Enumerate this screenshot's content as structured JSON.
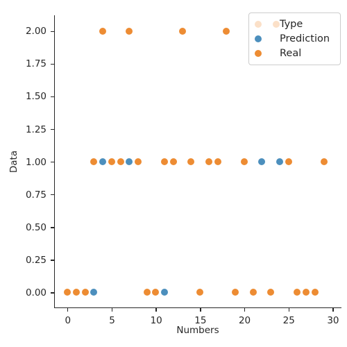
{
  "chart_data": {
    "type": "scatter",
    "title": "",
    "xlabel": "Numbers",
    "ylabel": "Data",
    "xlim": [
      -1.5,
      31.0
    ],
    "ylim": [
      -0.12,
      2.12
    ],
    "xticks": [
      0,
      5,
      10,
      15,
      20,
      25,
      30
    ],
    "xtick_labels": [
      "0",
      "5",
      "10",
      "15",
      "20",
      "25",
      "30"
    ],
    "yticks": [
      0.0,
      0.25,
      0.5,
      0.75,
      1.0,
      1.25,
      1.5,
      1.75,
      2.0
    ],
    "ytick_labels": [
      "0.00",
      "0.25",
      "0.50",
      "0.75",
      "1.00",
      "1.25",
      "1.50",
      "1.75",
      "2.00"
    ],
    "grid": false,
    "legend_position": "upper right",
    "legend_title": "Type",
    "series": [
      {
        "name": "Prediction",
        "color": "#4c8fbd",
        "points": [
          {
            "x": 3,
            "y": 0
          },
          {
            "x": 11,
            "y": 0
          },
          {
            "x": 4,
            "y": 1
          },
          {
            "x": 7,
            "y": 1
          },
          {
            "x": 22,
            "y": 1
          },
          {
            "x": 24,
            "y": 1
          }
        ]
      },
      {
        "name": "Real",
        "color": "#ed8c33",
        "points": [
          {
            "x": 0,
            "y": 0
          },
          {
            "x": 1,
            "y": 0
          },
          {
            "x": 2,
            "y": 0
          },
          {
            "x": 9,
            "y": 0
          },
          {
            "x": 10,
            "y": 0
          },
          {
            "x": 15,
            "y": 0
          },
          {
            "x": 19,
            "y": 0
          },
          {
            "x": 21,
            "y": 0
          },
          {
            "x": 23,
            "y": 0
          },
          {
            "x": 26,
            "y": 0
          },
          {
            "x": 27,
            "y": 0
          },
          {
            "x": 28,
            "y": 0
          },
          {
            "x": 3,
            "y": 1
          },
          {
            "x": 5,
            "y": 1
          },
          {
            "x": 6,
            "y": 1
          },
          {
            "x": 8,
            "y": 1
          },
          {
            "x": 11,
            "y": 1
          },
          {
            "x": 12,
            "y": 1
          },
          {
            "x": 14,
            "y": 1
          },
          {
            "x": 16,
            "y": 1
          },
          {
            "x": 17,
            "y": 1
          },
          {
            "x": 20,
            "y": 1
          },
          {
            "x": 25,
            "y": 1
          },
          {
            "x": 29,
            "y": 1
          },
          {
            "x": 4,
            "y": 2
          },
          {
            "x": 7,
            "y": 2
          },
          {
            "x": 13,
            "y": 2
          },
          {
            "x": 18,
            "y": 2
          }
        ]
      }
    ]
  },
  "legend": {
    "title": "Type",
    "title_swatch_color": "#fbe0c8",
    "entries": [
      {
        "label": "Prediction",
        "color": "#4c8fbd"
      },
      {
        "label": "Real",
        "color": "#ed8c33"
      }
    ]
  },
  "axes": {
    "xlabel": "Numbers",
    "ylabel": "Data"
  }
}
